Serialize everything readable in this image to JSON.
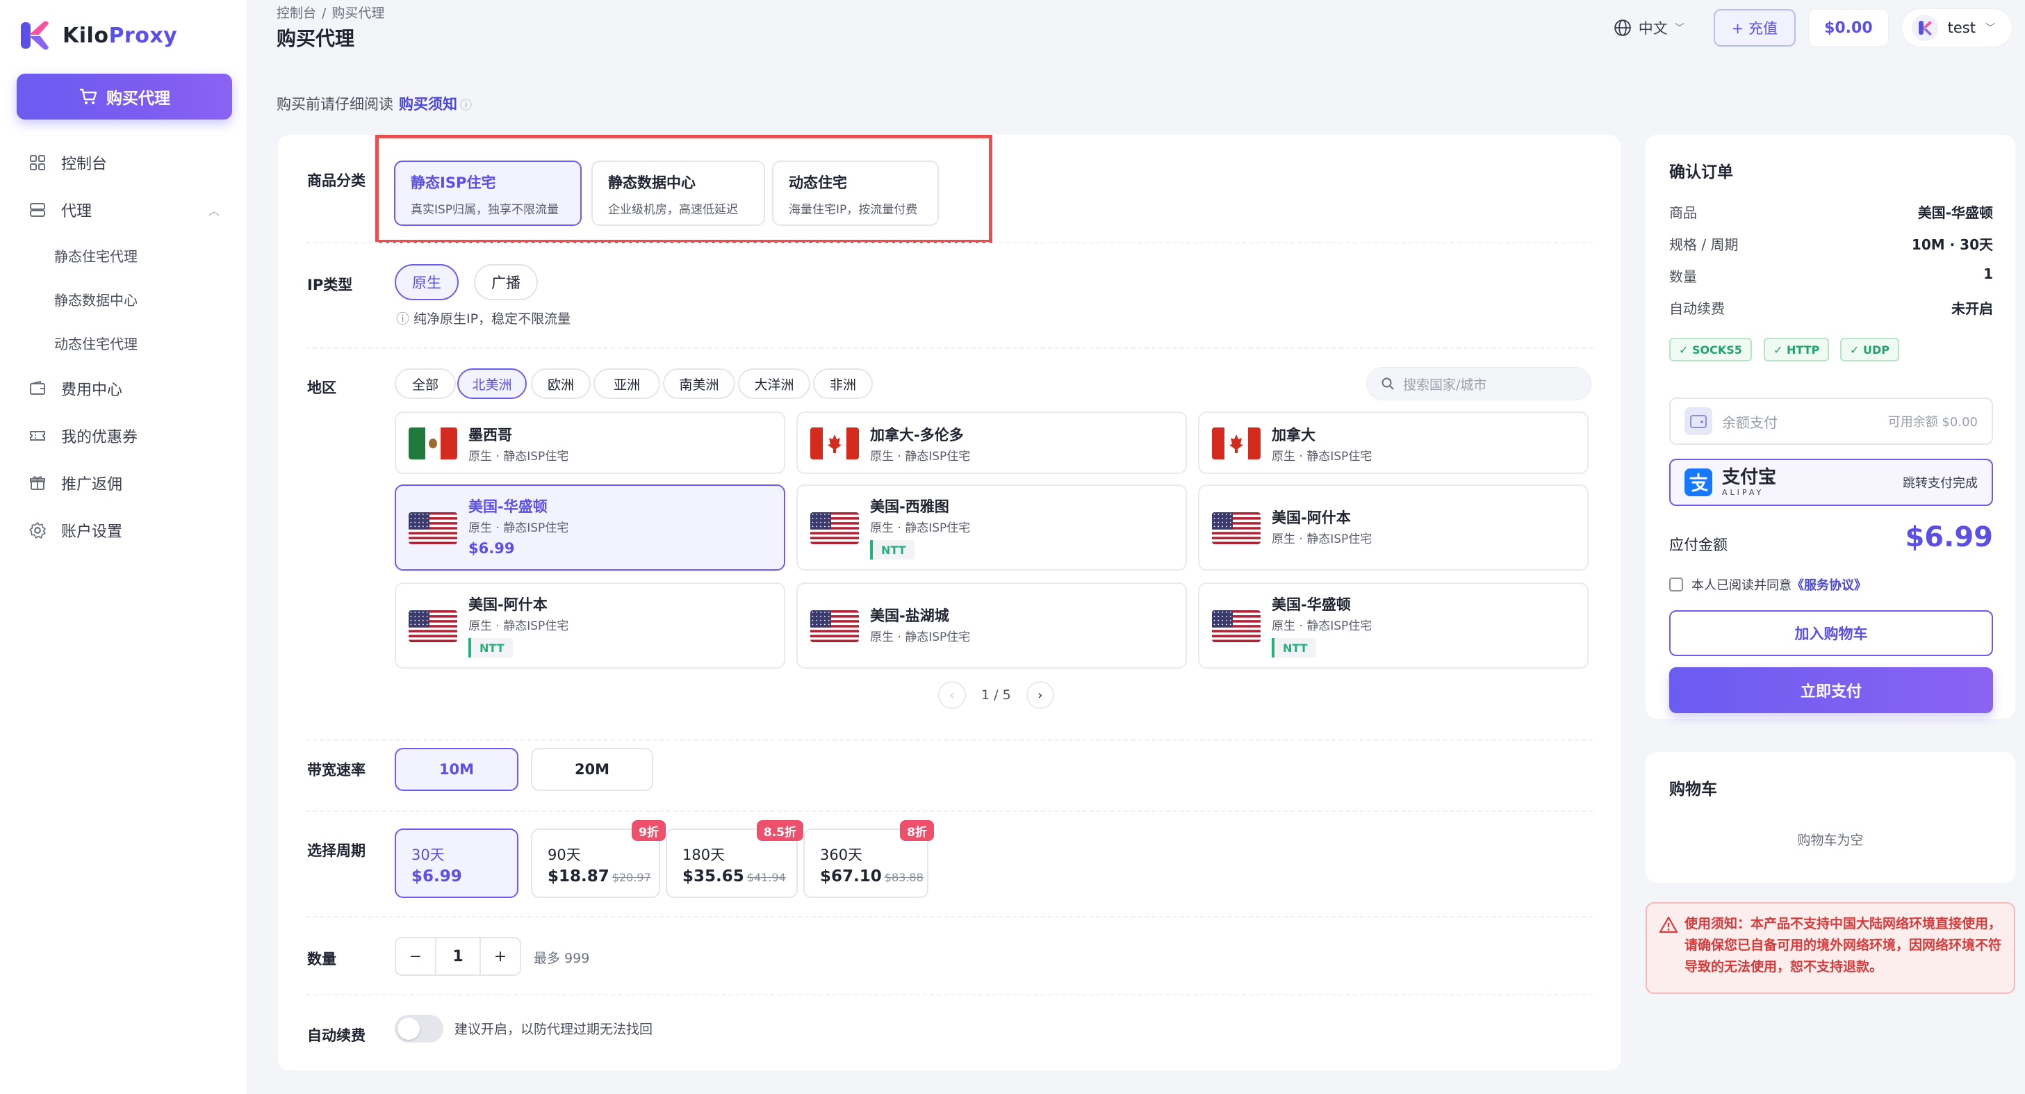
{
  "brand": {
    "name_a": "Kilo",
    "name_b": "Proxy"
  },
  "sidebar": {
    "buy_label": "购买代理",
    "items": [
      {
        "label": "控制台",
        "icon": "grid-icon"
      },
      {
        "label": "代理",
        "icon": "server-icon"
      },
      {
        "label": "费用中心",
        "icon": "wallet-icon"
      },
      {
        "label": "我的优惠券",
        "icon": "ticket-icon"
      },
      {
        "label": "推广返佣",
        "icon": "gift-icon"
      },
      {
        "label": "账户设置",
        "icon": "gear-icon"
      }
    ],
    "sub_items": [
      "静态住宅代理",
      "静态数据中心",
      "动态住宅代理"
    ]
  },
  "header": {
    "breadcrumb": [
      "控制台",
      "购买代理"
    ],
    "title": "购买代理",
    "language": "中文",
    "recharge": "+ 充值",
    "balance": "$0.00",
    "user": "test"
  },
  "notice": {
    "text": "购买前请仔细阅读",
    "link": "购买须知",
    "info": "ⓘ"
  },
  "categories": {
    "label": "商品分类",
    "items": [
      {
        "title": "静态ISP住宅",
        "desc": "真实ISP归属，独享不限流量"
      },
      {
        "title": "静态数据中心",
        "desc": "企业级机房，高速低延迟"
      },
      {
        "title": "动态住宅",
        "desc": "海量住宅IP，按流量付费"
      }
    ]
  },
  "ip_type": {
    "label": "IP类型",
    "options": [
      "原生",
      "广播"
    ],
    "hint": "纯净原生IP，稳定不限流量"
  },
  "region": {
    "label": "地区",
    "tabs": [
      "全部",
      "北美洲",
      "欧洲",
      "亚洲",
      "南美洲",
      "大洋洲",
      "非洲"
    ],
    "search_placeholder": "搜索国家/城市",
    "locations": [
      {
        "name": "墨西哥",
        "sub": "原生 · 静态ISP住宅"
      },
      {
        "name": "加拿大-多伦多",
        "sub": "原生 · 静态ISP住宅"
      },
      {
        "name": "加拿大",
        "sub": "原生 · 静态ISP住宅"
      },
      {
        "name": "美国-华盛顿",
        "sub": "原生 · 静态ISP住宅",
        "price": "$6.99"
      },
      {
        "name": "美国-西雅图",
        "sub": "原生 · 静态ISP住宅",
        "tag": "NTT"
      },
      {
        "name": "美国-阿什本",
        "sub": "原生 · 静态ISP住宅"
      },
      {
        "name": "美国-阿什本",
        "sub": "原生 · 静态ISP住宅",
        "tag": "NTT"
      },
      {
        "name": "美国-盐湖城",
        "sub": "原生 · 静态ISP住宅"
      },
      {
        "name": "美国-华盛顿",
        "sub": "原生 · 静态ISP住宅",
        "tag": "NTT"
      }
    ],
    "pager": {
      "prev": "‹",
      "text": "1 / 5",
      "next": "›"
    }
  },
  "bandwidth": {
    "label": "带宽速率",
    "options": [
      "10M",
      "20M"
    ]
  },
  "period": {
    "label": "选择周期",
    "options": [
      {
        "days": "30天",
        "price": "$6.99",
        "orig": "",
        "badge": ""
      },
      {
        "days": "90天",
        "price": "$18.87",
        "orig": "$20.97",
        "badge": "9折"
      },
      {
        "days": "180天",
        "price": "$35.65",
        "orig": "$41.94",
        "badge": "8.5折"
      },
      {
        "days": "360天",
        "price": "$67.10",
        "orig": "$83.88",
        "badge": "8折"
      }
    ]
  },
  "quantity": {
    "label": "数量",
    "minus": "−",
    "value": "1",
    "plus": "+",
    "max": "最多 999"
  },
  "auto_renew": {
    "label": "自动续费",
    "hint": "建议开启，以防代理过期无法找回"
  },
  "order": {
    "title": "确认订单",
    "rows": [
      {
        "k": "商品",
        "v": "美国-华盛顿"
      },
      {
        "k": "规格 / 周期",
        "v": "10M · 30天"
      },
      {
        "k": "数量",
        "v": "1"
      },
      {
        "k": "自动续费",
        "v": "未开启"
      }
    ],
    "protocols": [
      "✓ SOCKS5",
      "✓ HTTP",
      "✓ UDP"
    ],
    "balance_pay": {
      "name": "余额支付",
      "note": "可用余额 $0.00"
    },
    "alipay": {
      "name": "支付宝",
      "sub": "ALIPAY",
      "note": "跳转支付完成"
    },
    "amount_label": "应付金额",
    "amount": "$6.99",
    "agree_text": "本人已阅读并同意",
    "agree_link": "《服务协议》",
    "add_cart": "加入购物车",
    "pay_now": "立即支付"
  },
  "cart": {
    "title": "购物车",
    "empty": "购物车为空"
  },
  "warning": {
    "text": "使用须知：本产品不支持中国大陆网络环境直接使用，请确保您已自备可用的境外网络环境，因网络环境不符导致的无法使用，恕不支持退款。"
  },
  "colors": {
    "accent": "#5a4fe6",
    "danger": "#d83a3a",
    "success": "#1fb37a"
  }
}
